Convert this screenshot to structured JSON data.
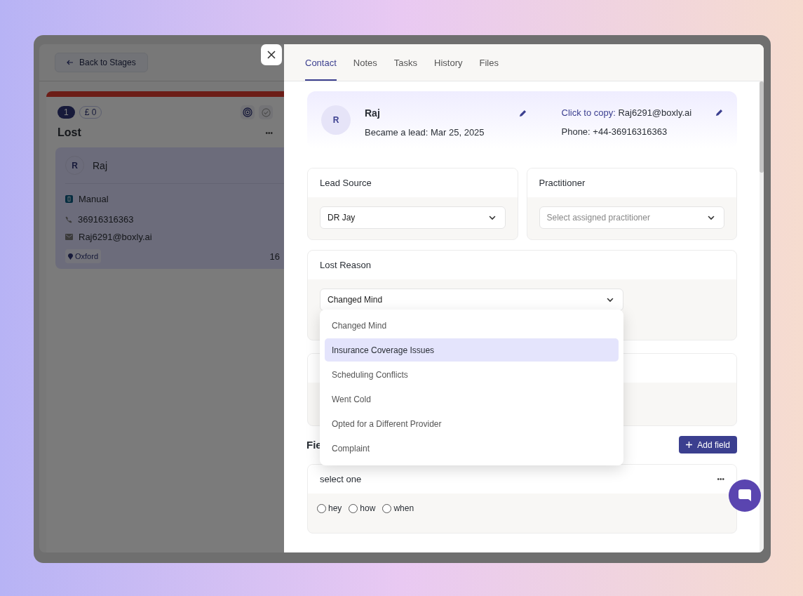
{
  "board": {
    "back_button": "Back to Stages",
    "stage": {
      "count": "1",
      "amount": "£ 0",
      "title": "Lost",
      "more": "•••"
    },
    "card": {
      "avatar": "R",
      "name": "Raj",
      "source": "Manual",
      "phone": "36916316363",
      "email": "Raj6291@boxly.ai",
      "location": "Oxford",
      "age": "16"
    }
  },
  "tabs": [
    {
      "label": "Contact",
      "selected": true
    },
    {
      "label": "Notes",
      "selected": false
    },
    {
      "label": "Tasks",
      "selected": false
    },
    {
      "label": "History",
      "selected": false
    },
    {
      "label": "Files",
      "selected": false
    }
  ],
  "contact": {
    "avatar": "R",
    "name": "Raj",
    "lead_label": "Became a lead:",
    "lead_date": "Mar 25, 2025",
    "copy_label": "Click to copy:",
    "email": "Raj6291@boxly.ai",
    "phone_label": "Phone:",
    "phone": "+44-36916316363"
  },
  "lead_source": {
    "title": "Lead Source",
    "value": "DR Jay"
  },
  "practitioner": {
    "title": "Practitioner",
    "placeholder": "Select assigned practitioner"
  },
  "lost_reason": {
    "title": "Lost Reason",
    "value": "Changed Mind",
    "expanded": true,
    "options": [
      {
        "label": "Changed Mind",
        "highlighted": false
      },
      {
        "label": "Insurance Coverage Issues",
        "highlighted": true
      },
      {
        "label": "Scheduling Conflicts",
        "highlighted": false
      },
      {
        "label": "Went Cold",
        "highlighted": false
      },
      {
        "label": "Opted for a Different Provider",
        "highlighted": false
      },
      {
        "label": "Complaint",
        "highlighted": false
      }
    ]
  },
  "fields_section": {
    "title": "Fie",
    "add_button": "Add field"
  },
  "custom_fields": [
    {
      "label": "select one",
      "more": "•••",
      "options": [
        {
          "label": "hey",
          "selected": false
        },
        {
          "label": "how",
          "selected": false
        },
        {
          "label": "when",
          "selected": false
        }
      ]
    }
  ]
}
